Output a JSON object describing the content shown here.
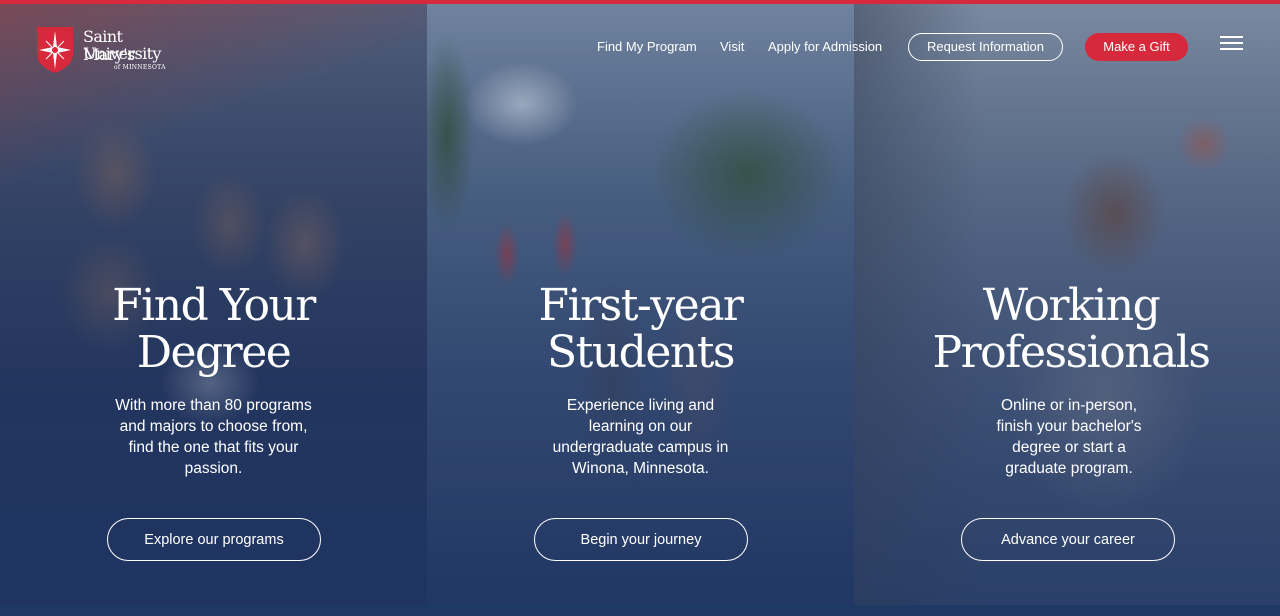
{
  "colors": {
    "brand_red": "#d6293b",
    "navy": "#1e3a64",
    "text": "#ffffff"
  },
  "header": {
    "logo": {
      "line1": "Saint Mary's",
      "line2": "University",
      "line3": "of MINNESOTA",
      "icon": "star-shield-icon"
    },
    "nav": [
      {
        "label": "Find My Program"
      },
      {
        "label": "Visit"
      },
      {
        "label": "Apply for Admission"
      }
    ],
    "request_info_label": "Request Information",
    "gift_label": "Make a Gift",
    "menu_icon": "hamburger-menu-icon"
  },
  "panels": [
    {
      "title_line1": "Find Your",
      "title_line2": "Degree",
      "desc_lines": [
        "With more than 80 programs",
        "and majors to choose from,",
        "find the one that fits your",
        "passion."
      ],
      "cta": "Explore our programs"
    },
    {
      "title_line1": "First-year",
      "title_line2": "Students",
      "desc_lines": [
        "Experience living and",
        "learning on our",
        "undergraduate campus in",
        "Winona, Minnesota."
      ],
      "cta": "Begin your journey"
    },
    {
      "title_line1": "Working",
      "title_line2": "Professionals",
      "desc_lines": [
        "Online or in-person,",
        "finish your bachelor's",
        "degree or start a",
        "graduate program."
      ],
      "cta": "Advance your career"
    }
  ]
}
